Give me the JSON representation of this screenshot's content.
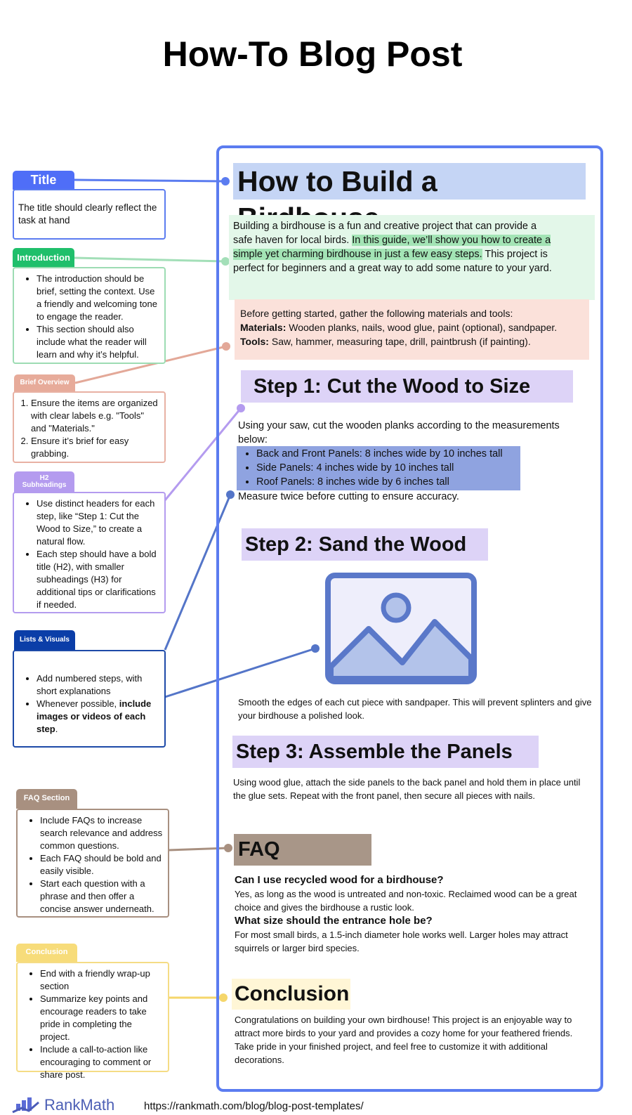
{
  "page_title": "How-To Blog Post",
  "annotations": {
    "title": {
      "label": "Title",
      "text": "The title should clearly reflect the task at hand"
    },
    "intro": {
      "label": "Introduction",
      "items": [
        "The introduction should be brief, setting the context. Use a friendly and welcoming tone to engage the reader.",
        "This section should  also include what the reader will learn and why it’s helpful."
      ]
    },
    "overview": {
      "label": "Brief Overview",
      "items": [
        "Ensure the items are organized with clear labels e.g. \"Tools\" and \"Materials.\"",
        "Ensure it’s brief for easy grabbing."
      ]
    },
    "h2": {
      "label": "H2 Subheadings",
      "items": [
        "Use distinct headers for each step, like “Step 1: Cut the Wood to Size,” to create a natural flow.",
        "Each step should have a bold title (H2), with smaller subheadings (H3) for additional tips or clarifications if needed."
      ]
    },
    "lists": {
      "label": "Lists & Visuals",
      "item1": "Add numbered steps, with short explanations",
      "item2_pre": "Whenever possible, ",
      "item2_bold": "include images or videos of each step",
      "item2_post": "."
    },
    "faq": {
      "label": "FAQ Section",
      "items": [
        "Include FAQs to increase search relevance and address common questions.",
        "Each FAQ should be bold and easily visible.",
        "Start each question with a phrase and then offer a concise answer underneath."
      ]
    },
    "conclusion": {
      "label": "Conclusion",
      "items": [
        "End with a friendly wrap-up section",
        "Summarize key points and encourage readers to take pride in completing the project.",
        "Include a call-to-action like encouraging to comment or share post."
      ]
    }
  },
  "post": {
    "h1": "How to Build a Birdhouse",
    "intro_a": "Building a birdhouse is a fun and creative project that can provide a safe haven for local birds. ",
    "intro_hl": "In this guide, we’ll show you how to create a simple yet charming birdhouse in just a few easy steps.",
    "intro_b": " This project is perfect for beginners and a great way to add some nature to your yard.",
    "materials_intro": "Before getting started, gather the following materials and tools:",
    "materials_label": "Materials:",
    "materials": " Wooden planks, nails, wood glue, paint (optional), sandpaper.",
    "tools_label": "Tools:",
    "tools": " Saw, hammer, measuring tape, drill, paintbrush (if painting).",
    "step1": {
      "title": "Step 1: Cut the Wood to Size",
      "text": "Using your saw, cut the wooden planks according to the measurements below:",
      "items": [
        "Back and Front Panels: 8 inches wide by 10 inches tall",
        "Side Panels: 4 inches wide by 10 inches tall",
        "Roof Panels: 8 inches wide by 6 inches tall"
      ],
      "tip": "Measure twice before cutting to ensure accuracy."
    },
    "step2": {
      "title": "Step 2: Sand the Wood",
      "text": "Smooth the edges of each cut piece with sandpaper. This will prevent splinters and give your birdhouse a polished look.",
      "image_icon": "image-placeholder-icon"
    },
    "step3": {
      "title": "Step 3: Assemble the Panels",
      "text": "Using wood glue, attach the side panels to the back panel and hold them in place until the glue sets. Repeat with the front panel, then secure all pieces with nails."
    },
    "faq": {
      "title": "FAQ",
      "q1": "Can I use recycled wood for a birdhouse?",
      "a1": "Yes, as long as the wood is untreated and non-toxic. Reclaimed wood can be a great choice and gives the birdhouse a rustic look.",
      "q2": "What size should the entrance hole be?",
      "a2": "For most small birds, a 1.5-inch diameter hole works well. Larger holes may attract squirrels or larger bird species."
    },
    "conclusion": {
      "title": "Conclusion",
      "text": "Congratulations on building your own birdhouse! This project is an enjoyable way to attract more birds to your yard and provides a cozy home for your feathered friends. Take pride in your finished project, and feel free to customize it with additional decorations."
    }
  },
  "footer": {
    "brand": "RankMath",
    "url": "https://rankmath.com/blog/blog-post-templates/"
  },
  "colors": {
    "frame": "#5b7cf0",
    "intro": "#1fbf6b",
    "overview": "#e7ab9a",
    "h2": "#b49bef",
    "lists": "#0b3ea8",
    "faq": "#a89080",
    "conclusion": "#f5d66b"
  }
}
